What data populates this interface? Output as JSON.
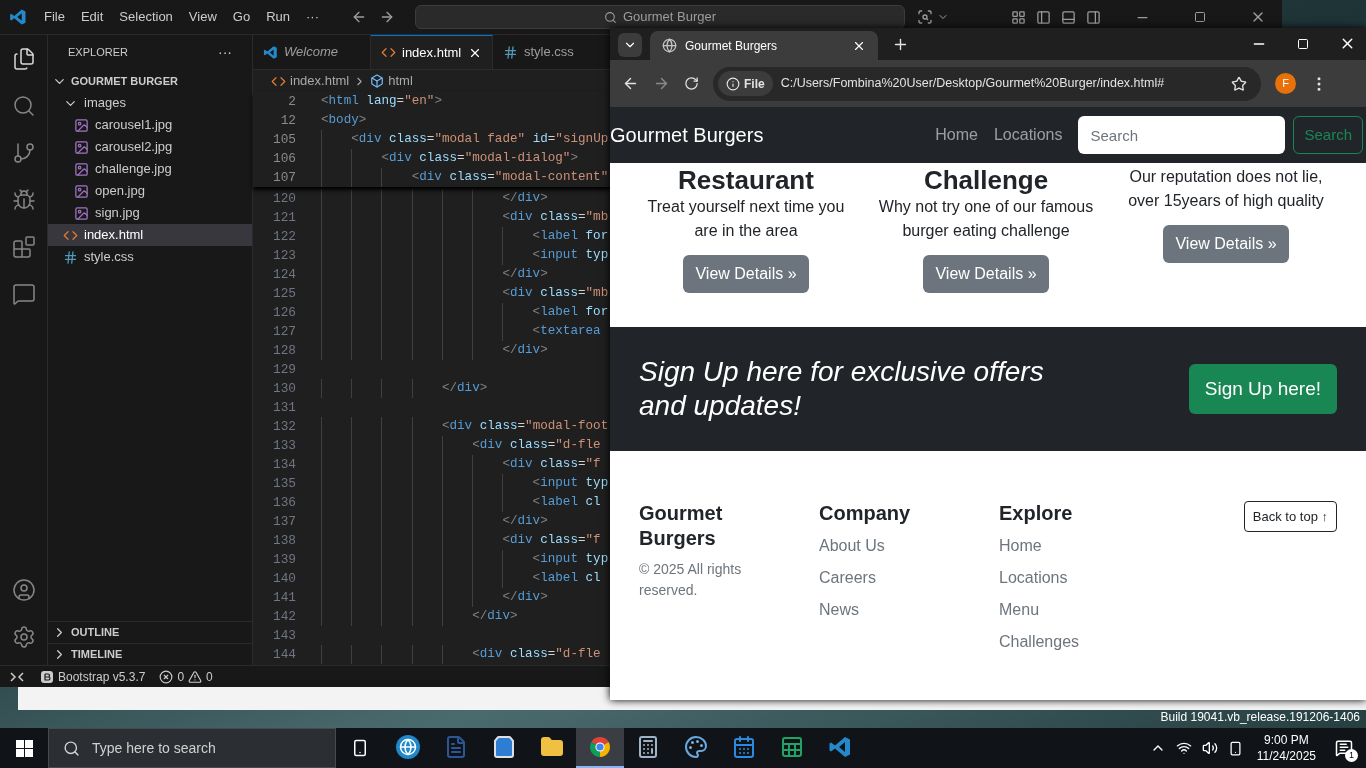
{
  "vscode": {
    "menu": [
      "File",
      "Edit",
      "Selection",
      "View",
      "Go",
      "Run",
      "···"
    ],
    "command_center": "Gourmet Burger",
    "explorer": {
      "title": "EXPLORER",
      "more": "···",
      "folder": {
        "name": "GOURMET BURGER",
        "expanded": true,
        "children": [
          {
            "name": "images",
            "kind": "folder",
            "expanded": true,
            "selected": false,
            "children": [
              {
                "name": "carousel1.jpg",
                "kind": "image",
                "selected": false
              },
              {
                "name": "carousel2.jpg",
                "kind": "image",
                "selected": false
              },
              {
                "name": "challenge.jpg",
                "kind": "image",
                "selected": false
              },
              {
                "name": "open.jpg",
                "kind": "image",
                "selected": false
              },
              {
                "name": "sign.jpg",
                "kind": "image",
                "selected": false
              }
            ]
          },
          {
            "name": "index.html",
            "kind": "html",
            "selected": true
          },
          {
            "name": "style.css",
            "kind": "css",
            "selected": false
          }
        ]
      }
    },
    "panels": [
      {
        "name": "OUTLINE",
        "expanded": false
      },
      {
        "name": "TIMELINE",
        "expanded": false
      }
    ],
    "tabs": [
      {
        "label": "Welcome",
        "kind": "welcome",
        "selected": false,
        "preview": true
      },
      {
        "label": "index.html",
        "kind": "html",
        "selected": true,
        "preview": false
      },
      {
        "label": "style.css",
        "kind": "css",
        "selected": false,
        "preview": false
      }
    ],
    "breadcrumbs": [
      {
        "label": "index.html",
        "kind": "html"
      },
      {
        "label": "html",
        "kind": "element"
      }
    ],
    "sticky_lines": [
      {
        "number": "2",
        "code": "<html lang=\"en\">"
      },
      {
        "number": "12",
        "code": "<body>"
      },
      {
        "number": "105",
        "code": "    <div class=\"modal fade\" id=\"signUp"
      },
      {
        "number": "106",
        "code": "        <div class=\"modal-dialog\">"
      },
      {
        "number": "107",
        "code": "            <div class=\"modal-content\""
      }
    ],
    "lines": [
      {
        "number": "120",
        "code": "                        </div>"
      },
      {
        "number": "121",
        "code": "                        <div class=\"mb"
      },
      {
        "number": "122",
        "code": "                            <label for"
      },
      {
        "number": "123",
        "code": "                            <input typ"
      },
      {
        "number": "124",
        "code": "                        </div>"
      },
      {
        "number": "125",
        "code": "                        <div class=\"mb"
      },
      {
        "number": "126",
        "code": "                            <label for"
      },
      {
        "number": "127",
        "code": "                            <textarea"
      },
      {
        "number": "128",
        "code": "                        </div>"
      },
      {
        "number": "129"
      },
      {
        "number": "130",
        "code": "                </div>"
      },
      {
        "number": "131"
      },
      {
        "number": "132",
        "code": "                <div class=\"modal-foot"
      },
      {
        "number": "133",
        "code": "                    <div class=\"d-fle"
      },
      {
        "number": "134",
        "code": "                        <div class=\"f"
      },
      {
        "number": "135",
        "code": "                            <input typ"
      },
      {
        "number": "136",
        "code": "                            <label cl"
      },
      {
        "number": "137",
        "code": "                        </div>"
      },
      {
        "number": "138",
        "code": "                        <div class=\"f"
      },
      {
        "number": "139",
        "code": "                            <input typ"
      },
      {
        "number": "140",
        "code": "                            <label cl"
      },
      {
        "number": "141",
        "code": "                        </div>"
      },
      {
        "number": "142",
        "code": "                    </div>"
      },
      {
        "number": "143"
      },
      {
        "number": "144",
        "code": "                    <div class=\"d-fle"
      }
    ],
    "status_bar": {
      "extension": "Bootstrap v5.3.7",
      "errors": "0",
      "warnings": "0"
    }
  },
  "browser": {
    "tabs": [
      {
        "title": "Gourmet Burgers",
        "selected": true
      }
    ],
    "url_chip": "File",
    "url": "C:/Users/Fombina%20User/Desktop/Gourmet%20Burger/index.html#",
    "profile": "F",
    "page": {
      "brand": "Gourmet Burgers",
      "nav_links": [
        "Home",
        "Locations"
      ],
      "search": {
        "placeholder": "Search",
        "button": "Search"
      },
      "cards": [
        {
          "heading": "Restaurant",
          "text": "Treat yourself next time you are in the area",
          "button": "View Details »"
        },
        {
          "heading": "Challenge",
          "text": "Why not try one of our famous burger eating challenge",
          "button": "View Details »"
        },
        {
          "text": "Our reputation does not lie, over 15years of high quality",
          "button": "View Details »"
        }
      ],
      "signup": {
        "text": "Sign Up here for exclusive offers and updates!",
        "button": "Sign Up here!"
      },
      "footer": {
        "brand": "Gourmet Burgers",
        "copyright": "© 2025 All rights reserved.",
        "columns": [
          {
            "title": "Company",
            "links": [
              "About Us",
              "Careers",
              "News"
            ]
          },
          {
            "title": "Explore",
            "links": [
              "Home",
              "Locations",
              "Menu",
              "Challenges"
            ]
          }
        ],
        "back_to_top": "Back to top ↑"
      }
    }
  },
  "desktop": {
    "build": "Build 19041.vb_release.191206-1406"
  },
  "taskbar": {
    "search_placeholder": "Type here to search",
    "apps": [
      {
        "kind": "globe",
        "selected": false
      },
      {
        "kind": "word",
        "selected": false
      },
      {
        "kind": "store",
        "selected": false
      },
      {
        "kind": "files",
        "selected": false
      },
      {
        "kind": "chrome",
        "selected": true
      },
      {
        "kind": "calculator",
        "selected": false
      },
      {
        "kind": "paint",
        "selected": false
      },
      {
        "kind": "calendar",
        "selected": false
      },
      {
        "kind": "excel",
        "selected": false
      },
      {
        "kind": "vscode",
        "selected": false
      }
    ],
    "time": "9:00 PM",
    "date": "11/24/2025",
    "notifications": "1"
  }
}
